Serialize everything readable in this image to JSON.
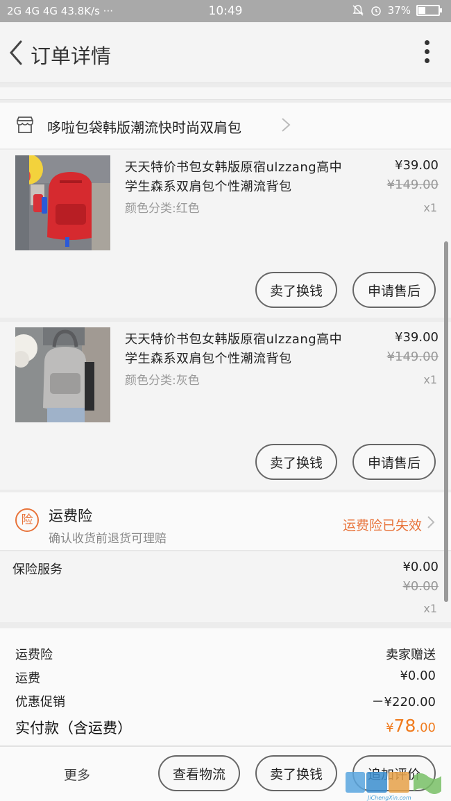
{
  "status_bar": {
    "signal": "2G 4G 4G 43.8K/s ···",
    "time": "10:49",
    "battery": "37%"
  },
  "nav": {
    "title": "订单详情"
  },
  "shop": {
    "name": "哆啦包袋韩版潮流快时尚双肩包"
  },
  "items": [
    {
      "title": "天天特价书包女韩版原宿ulzzang高中学生森系双肩包个性潮流背包",
      "variant": "颜色分类:红色",
      "price": "¥39.00",
      "original_price": "¥149.00",
      "qty": "x1",
      "btn_exchange": "卖了换钱",
      "btn_aftersale": "申请售后"
    },
    {
      "title": "天天特价书包女韩版原宿ulzzang高中学生森系双肩包个性潮流背包",
      "variant": "颜色分类:灰色",
      "price": "¥39.00",
      "original_price": "¥149.00",
      "qty": "x1",
      "btn_exchange": "卖了换钱",
      "btn_aftersale": "申请售后"
    }
  ],
  "insurance": {
    "icon_text": "险",
    "title": "运费险",
    "subtitle": "确认收货前退货可理赔",
    "status": "运费险已失效"
  },
  "service": {
    "label": "保险服务",
    "price": "¥0.00",
    "original_price": "¥0.00",
    "qty": "x1"
  },
  "summary": {
    "rows": [
      {
        "label": "运费险",
        "value": "卖家赠送"
      },
      {
        "label": "运费",
        "value": "¥0.00"
      },
      {
        "label": "优惠促销",
        "value": "－¥220.00"
      }
    ],
    "total_label": "实付款（含运费）",
    "total_currency": "¥",
    "total_int": "78",
    "total_dec": ".00"
  },
  "bottom": {
    "more": "更多",
    "logistics": "查看物流",
    "exchange": "卖了换钱",
    "review": "追加评价"
  },
  "watermark": {
    "text": "JiChengXin.com"
  },
  "colors": {
    "accent": "#e8733a",
    "price_orange": "#f07b1e"
  },
  "icons": [
    "back-icon",
    "more-vertical-icon",
    "shop-icon",
    "chevron-right-icon",
    "insurance-icon"
  ]
}
